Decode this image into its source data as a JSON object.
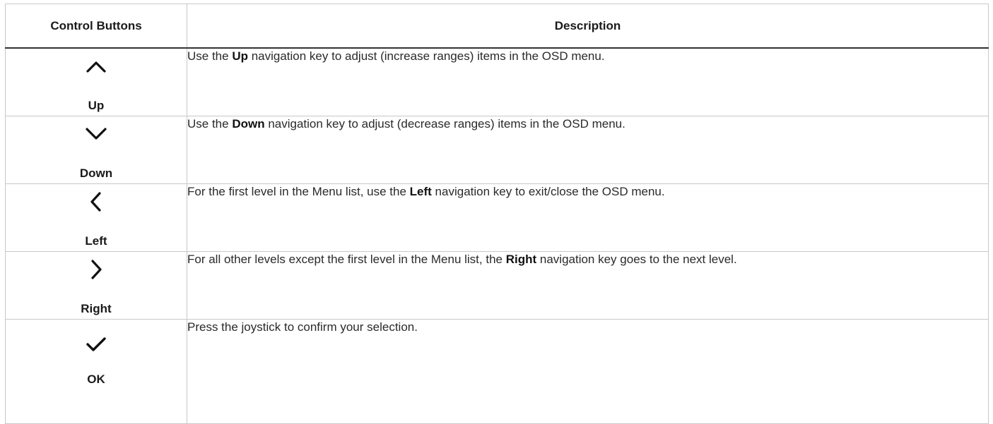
{
  "header": {
    "col1": "Control Buttons",
    "col2": "Description"
  },
  "rows": [
    {
      "icon": "chevron-up-icon",
      "label": "Up",
      "desc_pre": "Use the ",
      "desc_bold": "Up",
      "desc_post": " navigation key to adjust (increase ranges) items in the OSD menu."
    },
    {
      "icon": "chevron-down-icon",
      "label": "Down",
      "desc_pre": "Use the ",
      "desc_bold": "Down",
      "desc_post": " navigation key to adjust (decrease ranges) items in the OSD menu."
    },
    {
      "icon": "chevron-left-icon",
      "label": "Left",
      "desc_pre": "For the first level in the Menu list, use the ",
      "desc_bold": "Left",
      "desc_post": " navigation key to exit/close the OSD menu."
    },
    {
      "icon": "chevron-right-icon",
      "label": "Right",
      "desc_pre": "For all other levels except the first level in the Menu list, the ",
      "desc_bold": "Right",
      "desc_post": " navigation key goes to the next level."
    },
    {
      "icon": "checkmark-icon",
      "label": "OK",
      "desc_pre": "Press the joystick to confirm your selection.",
      "desc_bold": "",
      "desc_post": ""
    }
  ]
}
